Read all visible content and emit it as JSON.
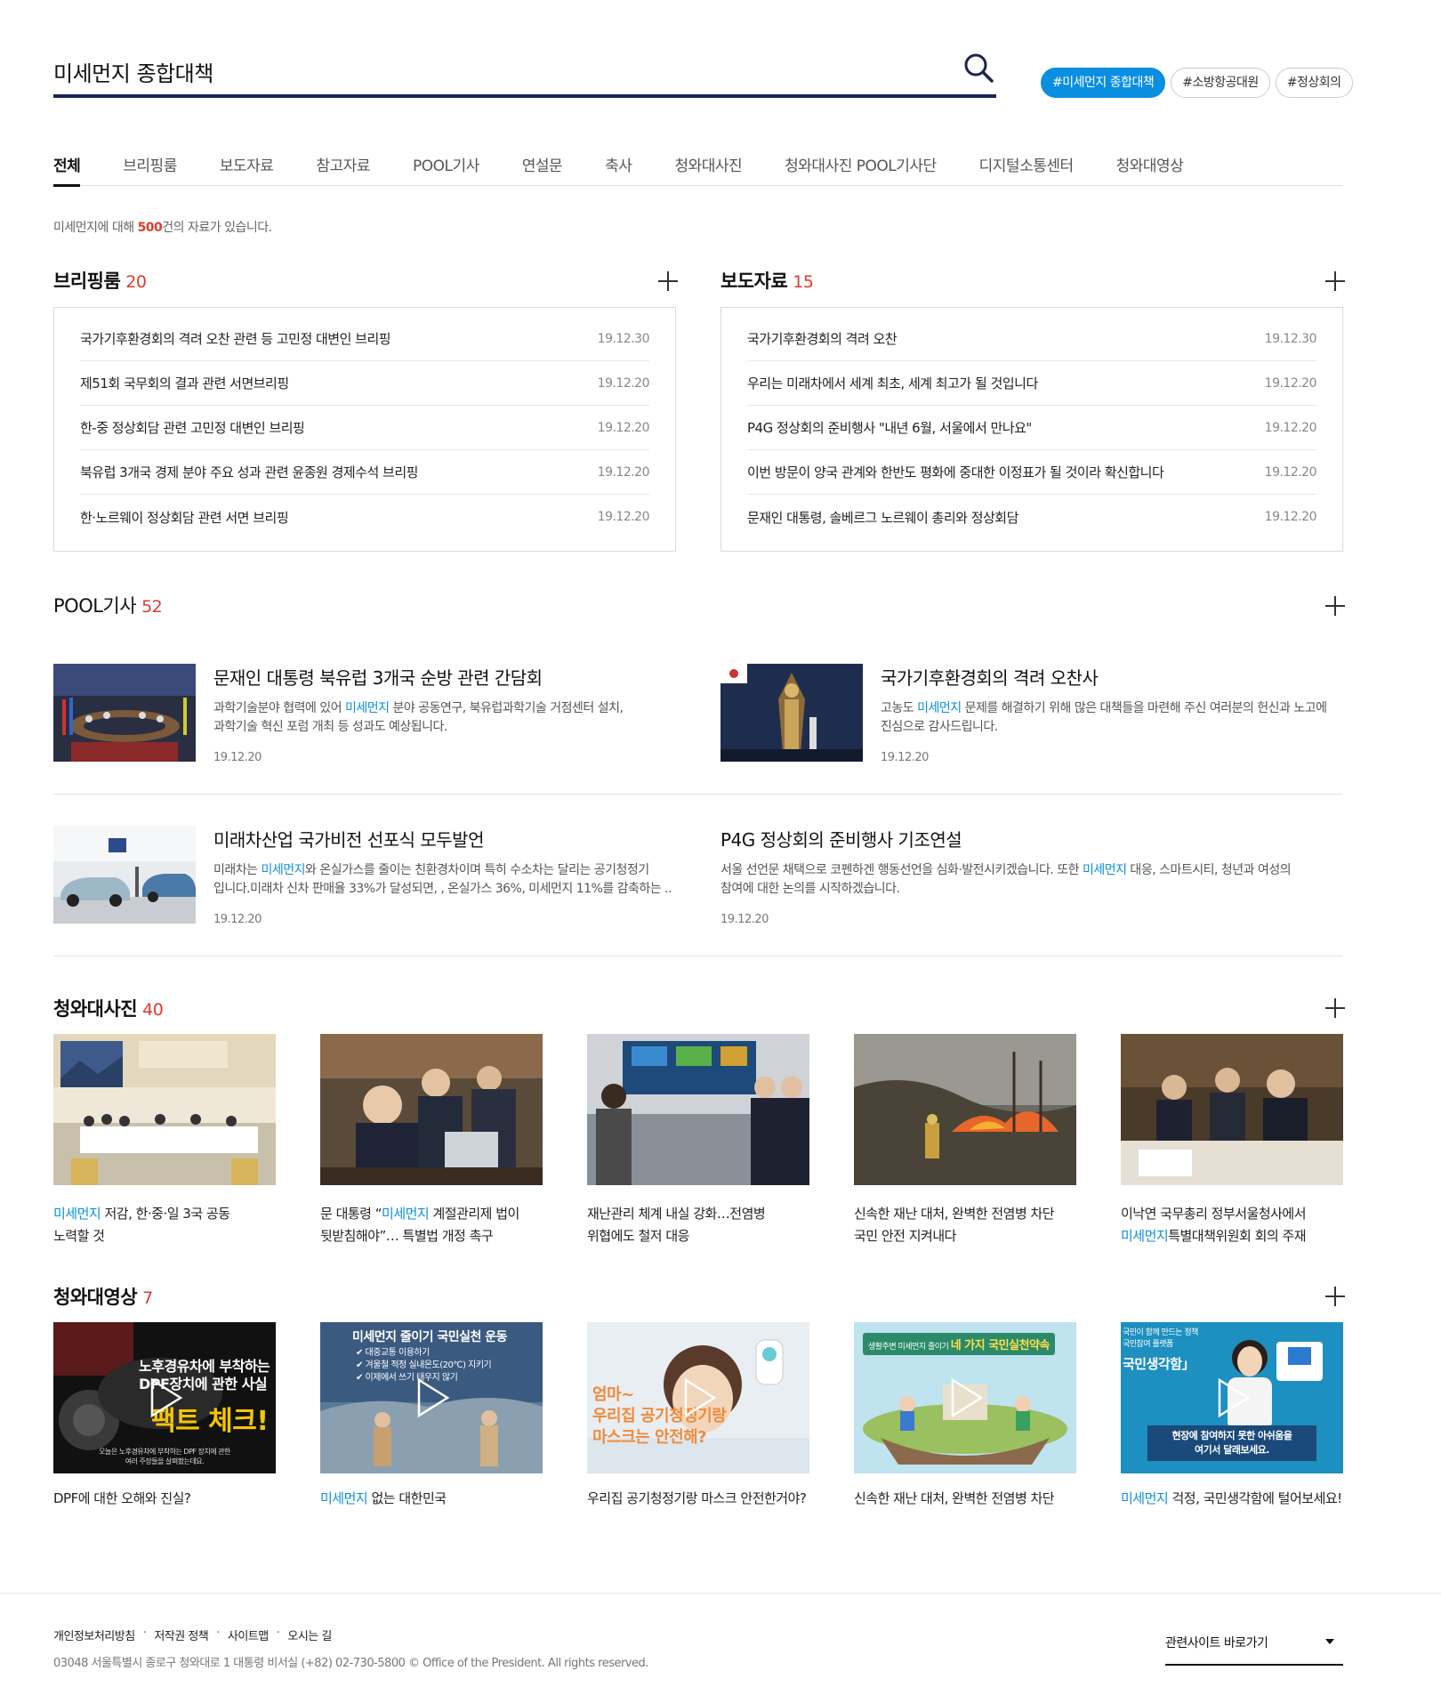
{
  "search": {
    "query": "미세먼지 종합대책",
    "icon": "search-icon"
  },
  "tags": [
    "#미세먼지 종합대책",
    "#소방항공대원",
    "#정상회의"
  ],
  "tabs": [
    "전체",
    "브리핑룸",
    "보도자료",
    "참고자료",
    "POOL기사",
    "연설문",
    "축사",
    "청와대사진",
    "청와대사진 POOL기사단",
    "디지털소통센터",
    "청와대영상"
  ],
  "result": {
    "pre": "미세먼지에 대해 ",
    "count": "500",
    "post": "건의 자료가 있습니다."
  },
  "briefing": {
    "title": "브리핑룸",
    "count": "20",
    "items": [
      {
        "t": "국가기후환경회의 격려 오찬 관련 등 고민정 대변인 브리핑",
        "d": "19.12.30"
      },
      {
        "t": "제51회 국무회의 결과 관련 서면브리핑",
        "d": "19.12.20"
      },
      {
        "t": "한-중 정상회담 관련 고민정 대변인 브리핑",
        "d": "19.12.20"
      },
      {
        "t": "북유럽 3개국 경제 분야 주요 성과 관련 윤종원 경제수석 브리핑",
        "d": "19.12.20"
      },
      {
        "t": "한·노르웨이 정상회담 관련 서면 브리핑",
        "d": "19.12.20"
      }
    ]
  },
  "press": {
    "title": "보도자료",
    "count": "15",
    "items": [
      {
        "t": "국가기후환경회의 격려 오찬",
        "d": "19.12.30"
      },
      {
        "t": "우리는 미래차에서 세계 최초, 세계 최고가 될 것입니다",
        "d": "19.12.20"
      },
      {
        "t": "P4G 정상회의 준비행사 \"내년 6월, 서울에서 만나요\"",
        "d": "19.12.20"
      },
      {
        "t": "이번 방문이 양국 관계와 한반도 평화에 중대한 이정표가 될 것이라 확신합니다",
        "d": "19.12.20"
      },
      {
        "t": "문재인 대통령, 솔베르그 노르웨이 총리와 정상회담",
        "d": "19.12.20"
      }
    ]
  },
  "pool": {
    "title": "POOL기사",
    "count": "52",
    "items": [
      {
        "title": "문재인 대통령 북유럽 3개국 순방 관련 간담회",
        "d1": "과학기술분야 협력에 있어 ",
        "hl": "미세먼지",
        "d2": " 분야 공동연구, 북유럽과학기술 거점센터 설치,",
        "d3": "과학기술 혁신 포럼 개최 등 성과도 예상됩니다.",
        "date": "19.12.20"
      },
      {
        "title": "국가기후환경회의 격려 오찬사",
        "d1": "고농도 ",
        "hl": "미세먼지",
        "d2": " 문제를 해결하기 위해 많은 대책들을 마련해 주신 여러분의 헌신과 노고에",
        "d3": "진심으로 감사드립니다.",
        "date": "19.12.20"
      },
      {
        "title": "미래차산업 국가비전 선포식 모두발언",
        "d1": "미래차는 ",
        "hl": "미세먼지",
        "d2": "와 온실가스를 줄이는 친환경차이며 특히 수소차는 달리는 공기청정기",
        "d3": "입니다.미래차 신차 판매율 33%가 달성되면, , 온실가스 36%, 미세먼지 11%를 감축하는 ..",
        "date": "19.12.20"
      },
      {
        "title": "P4G 정상회의 준비행사 기조연설",
        "d1": "서울 선언문 채택으로 코펜하겐 행동선언을 심화·발전시키겠습니다. 또한 ",
        "hl": "미세먼지",
        "d2": " 대응, 스마트시티, 청년과 여성의",
        "d3": "참여에 대한 논의를 시작하겠습니다.",
        "date": "19.12.20"
      }
    ]
  },
  "photos": {
    "title": "청와대사진",
    "count": "40",
    "items": [
      {
        "a": "",
        "hl": "미세먼지",
        "b": " 저감, 한·중·일 3국 공동",
        "c": "노력할 것"
      },
      {
        "a": "문 대통령 “",
        "hl": "미세먼지",
        "b": " 계절관리제 법이",
        "c": "뒷받침해야”… 특별법 개정 촉구"
      },
      {
        "a": "재난관리 체계 내실 강화…전염병",
        "hl": "",
        "b": "",
        "c": "위협에도 철저 대응"
      },
      {
        "a": "신속한 재난 대처, 완벽한 전염병 차단",
        "hl": "",
        "b": "",
        "c": "국민 안전 지켜내다"
      },
      {
        "a": "이낙연 국무총리 정부서울청사에서",
        "hl": "미세먼지",
        "b": "특별대책위원회 회의 주재",
        "c": ""
      }
    ]
  },
  "videos": {
    "title": "청와대영상",
    "count": "7",
    "items": [
      {
        "a": "DPF에 대한 오해와 진실?",
        "hl": "",
        "b": "",
        "thumb": [
          "노후경유차에 부착하는",
          "DPF장치에 관한 사실",
          "팩트 체크!",
          "오늘은 노후경유차에 부착하는 DPF 장치에 관한",
          "여러 주장들을 살펴봤는데요."
        ]
      },
      {
        "a": "",
        "hl": "미세먼지",
        "b": " 없는 대한민국",
        "thumb": [
          "미세먼지 줄이기 국민실천 운동",
          "✔ 대중교통 이용하기",
          "✔ 겨울철 적정 실내온도(20℃) 지키기",
          "✔ 이제에서 쓰기 태우지 않기"
        ]
      },
      {
        "a": "우리집 공기청정기랑 마스크 안전한거야?",
        "hl": "",
        "b": "",
        "thumb": [
          "엄마~",
          "우리집 공기청정기랑",
          "마스크는 안전해?"
        ]
      },
      {
        "a": "신속한 재난 대처, 완벽한 전염병 차단",
        "hl": "",
        "b": "",
        "thumb": [
          "생활주변 미세먼지 줄이기",
          "네 가지 국민실천약속"
        ]
      },
      {
        "a": "",
        "hl": "미세먼지",
        "b": " 걱정, 국민생각함에 털어보세요!",
        "thumb": [
          "국민이 함께 만드는 정책",
          "국민참여 플랫폼",
          "국민생각함」",
          "현장에 참여하지 못한 아쉬움을",
          "여기서 달래보세요."
        ]
      }
    ]
  },
  "footer": {
    "links": [
      "개인정보처리방침",
      "저작권 정책",
      "사이트맵",
      "오시는 길"
    ],
    "address": "03048 서울특별시 종로구 청와대로 1 대통령 비서실   (+82) 02-730-5800  © Office of the President. All rights reserved.",
    "select": "관련사이트 바로가기"
  },
  "colors": {
    "accent": "#0a8fe0",
    "count": "#e03a2f",
    "navy": "#1a2552"
  }
}
